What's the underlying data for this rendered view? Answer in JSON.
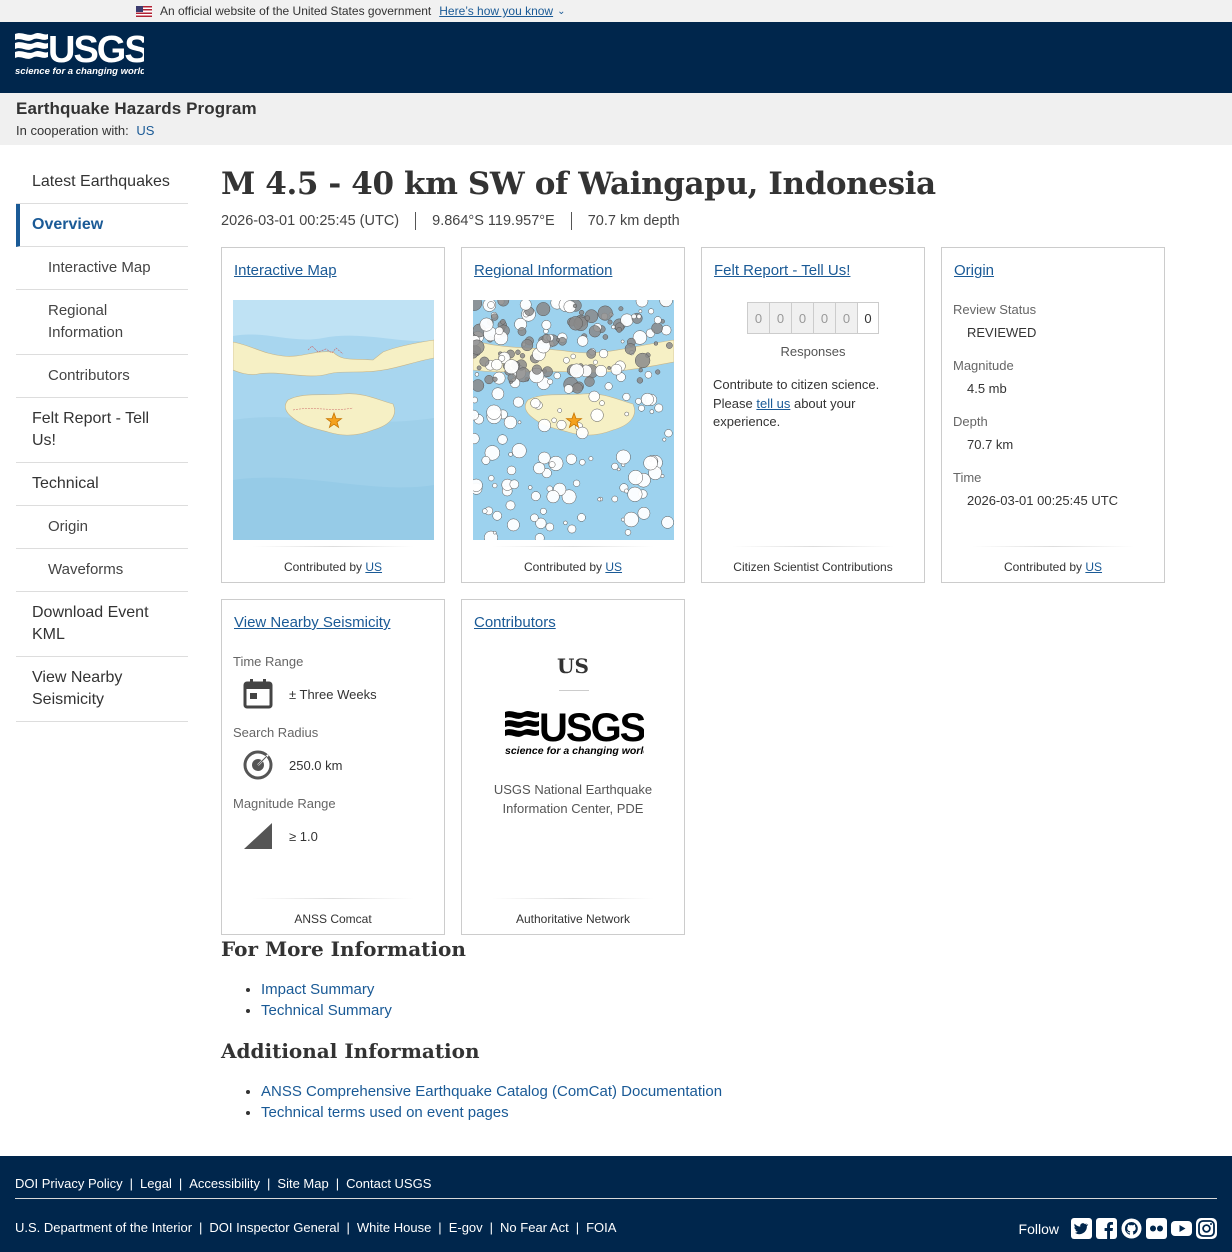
{
  "gov_banner": {
    "text": "An official website of the United States government",
    "link": "Here’s how you know"
  },
  "program": {
    "title": "Earthquake Hazards Program",
    "coop_label": "In cooperation with:",
    "coop_link": "US"
  },
  "sidebar": {
    "items": [
      {
        "label": "Latest Earthquakes"
      },
      {
        "label": "Overview"
      },
      {
        "label": "Interactive Map"
      },
      {
        "label": "Regional Information"
      },
      {
        "label": "Contributors"
      },
      {
        "label": "Felt Report - Tell Us!"
      },
      {
        "label": "Technical"
      },
      {
        "label": "Origin"
      },
      {
        "label": "Waveforms"
      },
      {
        "label": "Download Event KML"
      },
      {
        "label": "View Nearby Seismicity"
      }
    ]
  },
  "event": {
    "title": "M 4.5 - 40 km SW of Waingapu, Indonesia",
    "time": "2026-03-01 00:25:45 (UTC)",
    "location": "9.864°S 119.957°E",
    "depth": "70.7 km depth"
  },
  "cards": {
    "interactive_map": {
      "title": "Interactive Map",
      "footer_prefix": "Contributed by",
      "footer_link": "US"
    },
    "regional": {
      "title": "Regional Information",
      "footer_prefix": "Contributed by",
      "footer_link": "US"
    },
    "felt": {
      "title": "Felt Report - Tell Us!",
      "digits": [
        "0",
        "0",
        "0",
        "0",
        "0",
        "0"
      ],
      "responses": "Responses",
      "text_before": "Contribute to citizen science. Please",
      "text_link": "tell us",
      "text_after": "about your experience.",
      "footer": "Citizen Scientist Contributions"
    },
    "origin": {
      "title": "Origin",
      "review_label": "Review Status",
      "review_value": "REVIEWED",
      "magnitude_label": "Magnitude",
      "magnitude_value": "4.5 mb",
      "depth_label": "Depth",
      "depth_value": "70.7 km",
      "time_label": "Time",
      "time_value": "2026-03-01 00:25:45 UTC",
      "footer_prefix": "Contributed by",
      "footer_link": "US"
    },
    "nearby": {
      "title": "View Nearby Seismicity",
      "time_label": "Time Range",
      "time_value": "± Three Weeks",
      "radius_label": "Search Radius",
      "radius_value": "250.0 km",
      "mag_label": "Magnitude Range",
      "mag_value": "≥ 1.0",
      "footer": "ANSS Comcat"
    },
    "contributors": {
      "title": "Contributors",
      "code": "US",
      "name": "USGS National Earthquake Information Center, PDE",
      "footer": "Authoritative Network"
    }
  },
  "more_info": {
    "heading": "For More Information",
    "links": [
      "Impact Summary",
      "Technical Summary"
    ]
  },
  "additional": {
    "heading": "Additional Information",
    "links": [
      "ANSS Comprehensive Earthquake Catalog (ComCat) Documentation",
      "Technical terms used on event pages"
    ]
  },
  "footer": {
    "row1": [
      "DOI Privacy Policy",
      "Legal",
      "Accessibility",
      "Site Map",
      "Contact USGS"
    ],
    "row2": [
      "U.S. Department of the Interior",
      "DOI Inspector General",
      "White House",
      "E-gov",
      "No Fear Act",
      "FOIA"
    ],
    "follow": "Follow",
    "social_icons": [
      "twitter-icon",
      "facebook-icon",
      "github-icon",
      "flickr-icon",
      "youtube-icon",
      "instagram-icon"
    ]
  },
  "colors": {
    "header": "#00264c",
    "link": "#1a5a96",
    "epicenter_star": "#f5a11e"
  }
}
